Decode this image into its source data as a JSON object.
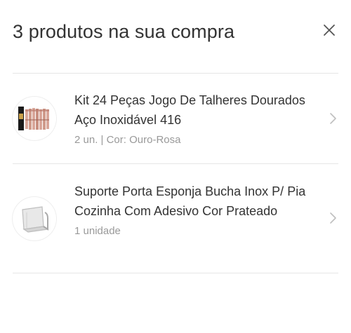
{
  "modal": {
    "title": "3 produtos na sua compra",
    "close_icon": "close-icon"
  },
  "products": [
    {
      "name": "Kit 24 Peças Jogo De Talheres Dourados Aço Inoxidável 416",
      "meta": "2 un. | Cor: Ouro-Rosa",
      "thumbnail": "cutlery-set-thumbnail"
    },
    {
      "name": "Suporte Porta Esponja Bucha Inox P/ Pia Cozinha Com Adesivo Cor Prateado",
      "meta": "1 unidade",
      "thumbnail": "sponge-holder-thumbnail"
    }
  ],
  "colors": {
    "text": "#333333",
    "muted": "#999999",
    "divider": "#e6e6e6",
    "chevron": "#bfbfbf"
  }
}
